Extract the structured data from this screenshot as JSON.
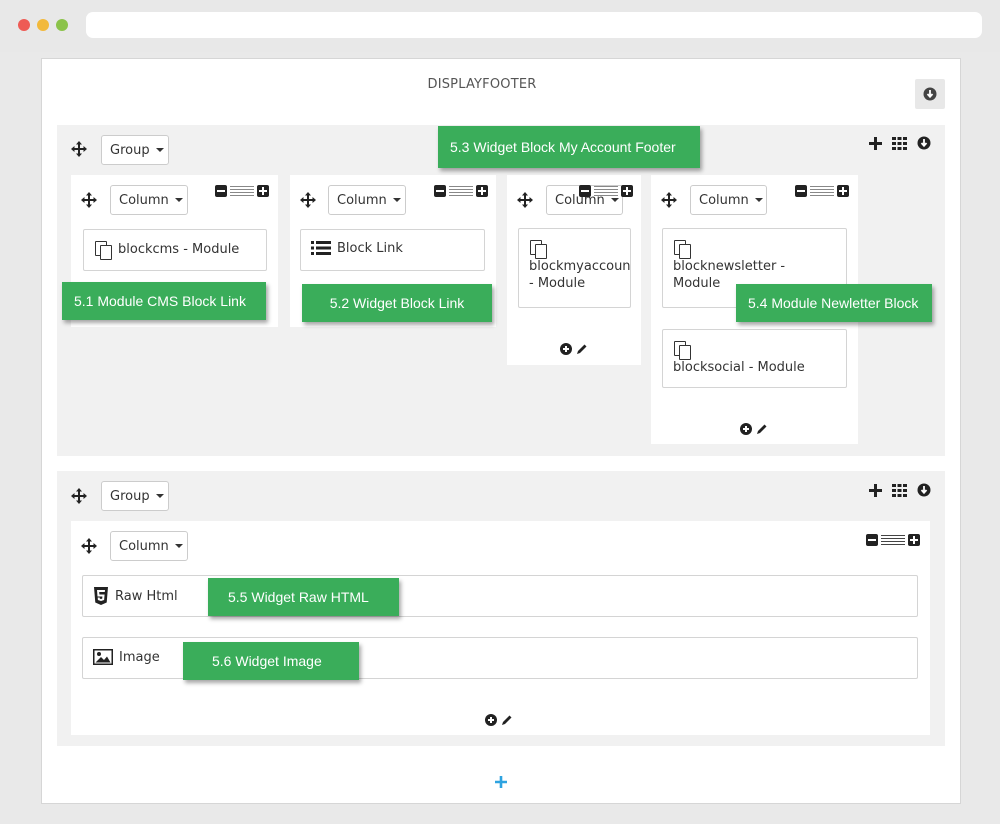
{
  "hook": {
    "title": "DISPLAYFOOTER"
  },
  "groups": [
    {
      "label": "Group",
      "columns": [
        {
          "label": "Column",
          "modules": [
            {
              "text": "blockcms - Module"
            }
          ]
        },
        {
          "label": "Column",
          "modules": [
            {
              "text": "Block Link"
            }
          ]
        },
        {
          "label": "Column",
          "modules": [
            {
              "text": "blockmyaccountfooter",
              "sub": "- Module"
            }
          ]
        },
        {
          "label": "Column",
          "modules": [
            {
              "text": "blocknewsletter -",
              "sub": "Module"
            },
            {
              "text": "blocksocial - Module"
            }
          ]
        }
      ]
    },
    {
      "label": "Group",
      "columns": [
        {
          "label": "Column",
          "modules": [
            {
              "text": "Raw Html"
            },
            {
              "text": "Image"
            }
          ]
        }
      ]
    }
  ],
  "callouts": {
    "c51": "5.1 Module CMS Block Link",
    "c52": "5.2 Widget Block Link",
    "c53": "5.3 Widget Block My Account Footer",
    "c54": "5.4 Module Newletter Block",
    "c55": "5.5 Widget Raw HTML",
    "c56": "5.6 Widget Image"
  },
  "colors": {
    "callout": "#3aad5a",
    "add": "#2ea3e0"
  }
}
